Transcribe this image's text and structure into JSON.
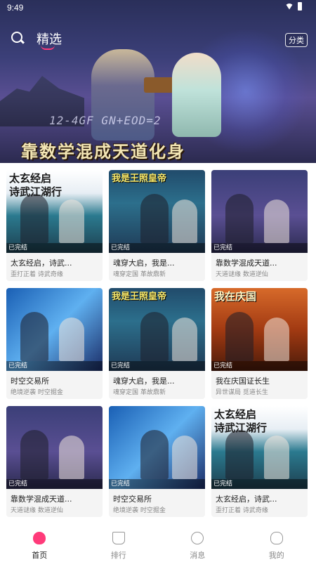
{
  "status_bar": {
    "time": "9:49"
  },
  "header": {
    "tab_active": "精选",
    "category_button": "分类"
  },
  "banner": {
    "title": "靠数学混成天道化身",
    "formula": "12-4GF GN+EOD=2"
  },
  "books": [
    {
      "cover_theme": "taixuan",
      "cover_caption": "太玄经启\n诗武江湖行",
      "status": "已完结",
      "title": "太玄经启，诗武...",
      "tags": "歪打正着 诗武奇缘"
    },
    {
      "cover_theme": "hunchuan",
      "cover_caption": "我是王照皇帝",
      "status": "已完结",
      "title": "魂穿大启，我是...",
      "tags": "魂穿定国 革故鼎新"
    },
    {
      "cover_theme": "shuxue",
      "cover_caption": "",
      "status": "已完结",
      "title": "靠数学混成天道...",
      "tags": "天道谜缘 数道逆仙"
    },
    {
      "cover_theme": "shikong",
      "cover_caption": "",
      "status": "已完结",
      "title": "时空交易所",
      "tags": "绝境逆袭 时空掘金"
    },
    {
      "cover_theme": "hunchuan",
      "cover_caption": "我是王照皇帝",
      "status": "已完结",
      "title": "魂穿大启，我是...",
      "tags": "魂穿定国 革故鼎新"
    },
    {
      "cover_theme": "qingguo",
      "cover_caption": "我在庆国",
      "status": "已完结",
      "title": "我在庆国证长生",
      "tags": "异世谋局 觅道长生"
    },
    {
      "cover_theme": "shuxue",
      "cover_caption": "",
      "status": "已完结",
      "title": "靠数学混成天道...",
      "tags": "天道谜缘 数道逆仙"
    },
    {
      "cover_theme": "shikong",
      "cover_caption": "",
      "status": "已完结",
      "title": "时空交易所",
      "tags": "绝境逆袭 时空掘金"
    },
    {
      "cover_theme": "taixuan",
      "cover_caption": "太玄经启\n诗武江湖行",
      "status": "已完结",
      "title": "太玄经启，诗武...",
      "tags": "歪打正着 诗武奇缘"
    }
  ],
  "bottom_nav": [
    {
      "label": "首页",
      "icon": "home-icon",
      "active": true
    },
    {
      "label": "排行",
      "icon": "rank-icon",
      "active": false
    },
    {
      "label": "消息",
      "icon": "message-icon",
      "active": false
    },
    {
      "label": "我的",
      "icon": "profile-icon",
      "active": false
    }
  ],
  "colors": {
    "accent": "#ff3b7a"
  }
}
